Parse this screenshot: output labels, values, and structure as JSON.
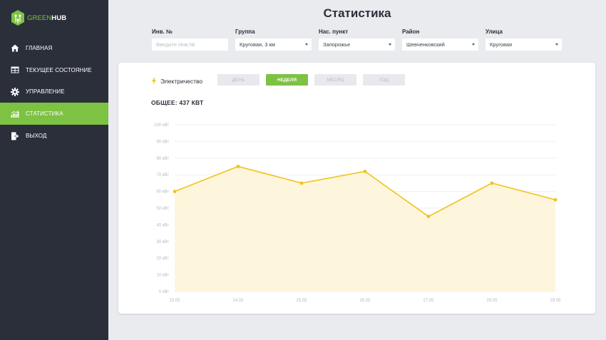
{
  "app": {
    "logo_green": "GREEN",
    "logo_white": "HUB"
  },
  "sidebar": {
    "items": [
      {
        "label": "ГЛАВНАЯ",
        "icon": "home-icon",
        "active": false
      },
      {
        "label": "ТЕКУЩЕЕ СОСТОЯНИЕ",
        "icon": "table-icon",
        "active": false
      },
      {
        "label": "УПРАВЛЕНИЕ",
        "icon": "gear-icon",
        "active": false
      },
      {
        "label": "СТАТИСТИКА",
        "icon": "chart-icon",
        "active": true
      },
      {
        "label": "ВЫХОД",
        "icon": "exit-icon",
        "active": false
      }
    ]
  },
  "header": {
    "title": "Статистика"
  },
  "filters": {
    "inv": {
      "label": "Инв. №",
      "value": "",
      "placeholder": "Введите Инв.№"
    },
    "group": {
      "label": "Группа",
      "value": "Круговая, 3 км"
    },
    "city": {
      "label": "Нас. пункт",
      "value": "Запорожье"
    },
    "district": {
      "label": "Район",
      "value": "Шевченковский"
    },
    "street": {
      "label": "Улица",
      "value": "Круговая"
    }
  },
  "panel": {
    "resource_label": "Электричество",
    "tabs": [
      {
        "label": "ДЕНЬ",
        "active": false
      },
      {
        "label": "НЕДЕЛЯ",
        "active": true
      },
      {
        "label": "МЕСЯЦ",
        "active": false
      },
      {
        "label": "ГОД",
        "active": false
      }
    ],
    "total_label": "ОБЩЕЕ: 437 КВТ"
  },
  "colors": {
    "accent": "#7dc242",
    "sidebar_bg": "#2a2f3a",
    "line": "#f2c21b",
    "area": "#fdf6dc"
  },
  "chart_data": {
    "type": "area",
    "x": [
      "23.05",
      "24.05",
      "25.05",
      "26.05",
      "27.05",
      "28.05",
      "29.05"
    ],
    "series": [
      {
        "values": [
          60,
          75,
          65,
          72,
          45,
          65,
          55
        ]
      }
    ],
    "ylim": [
      0,
      100
    ],
    "yticks": [
      0,
      10,
      20,
      30,
      40,
      50,
      60,
      70,
      80,
      90,
      100
    ],
    "ytick_labels": [
      "0 кВт",
      "10 кВт",
      "20 кВт",
      "30 кВт",
      "40 кВт",
      "50 кВт",
      "60 кВт",
      "70 кВт",
      "80 кВт",
      "90 кВт",
      "100 кВт"
    ],
    "grid": true
  }
}
